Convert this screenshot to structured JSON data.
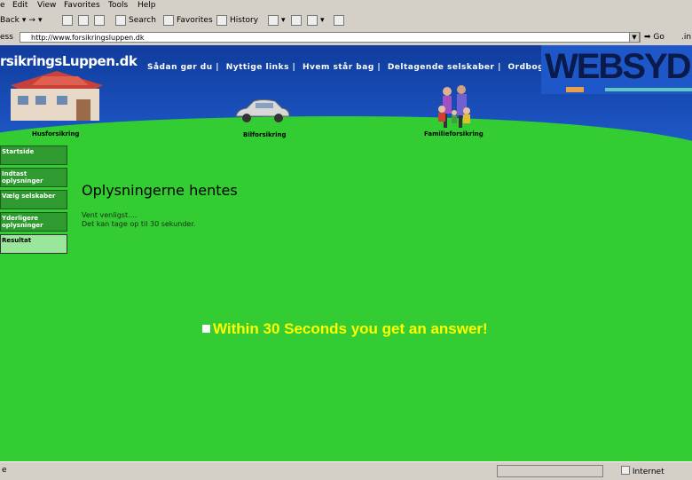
{
  "menu": [
    "e",
    "Edit",
    "View",
    "Favorites",
    "Tools",
    "Help"
  ],
  "toolbar": {
    "back": "Back",
    "search": "Search",
    "favorites": "Favorites",
    "history": "History"
  },
  "address": {
    "label": "ess",
    "url": "http://www.forsikringsluppen.dk",
    "go": "Go",
    "links": ".in"
  },
  "banner": {
    "logo": "rsikringsLuppen.dk",
    "nav": [
      "Sådan gør du |",
      "Nyttige links |",
      "Hvem står bag |",
      "Deltagende selskaber |",
      "Ordbog"
    ],
    "partner_logo": "WEBSYDIAN",
    "captions": {
      "house": "Husforsikring",
      "car": "Bilforsikring",
      "family": "Familieforsikring"
    }
  },
  "sidebar": [
    {
      "label": "Startside",
      "active": false
    },
    {
      "label": "Indtast oplysninger",
      "active": false
    },
    {
      "label": "Vælg selskaber",
      "active": false
    },
    {
      "label": "Yderligere oplysninger",
      "active": false
    },
    {
      "label": "Resultat",
      "active": true
    }
  ],
  "main": {
    "heading": "Oplysningerne hentes",
    "line1": "Vent venligst....",
    "line2": "Det kan tage op til 30 sekunder."
  },
  "overlay_text": "Within 30 Seconds you get an  answer!",
  "status": {
    "left": "e",
    "zone": "Internet"
  },
  "colors": {
    "page_bg": "#33cc33",
    "banner": "#1e58c8",
    "overlay": "#ffff00"
  }
}
